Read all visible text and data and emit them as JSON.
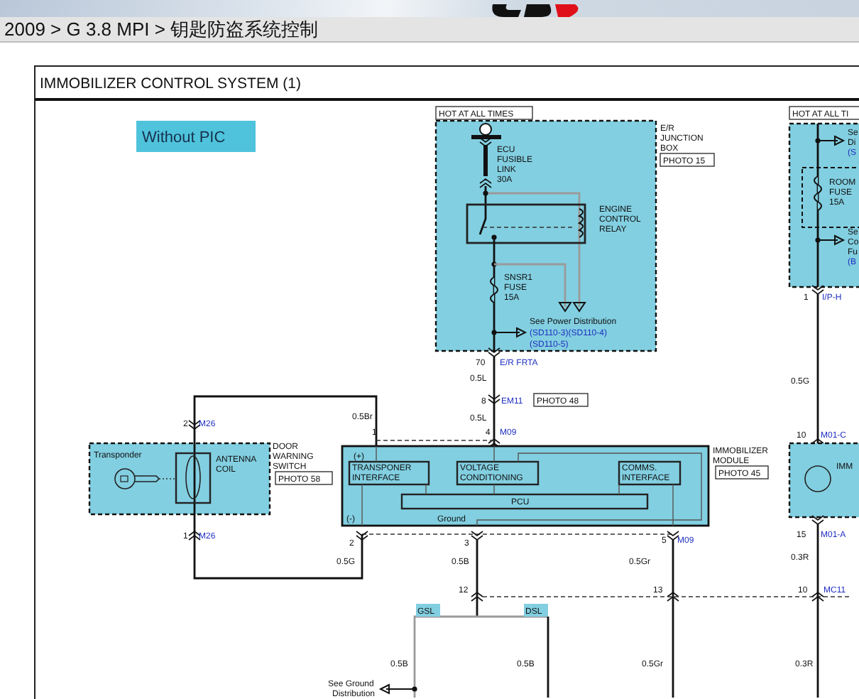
{
  "header": {
    "breadcrumb": "2009 > G 3.8 MPI > 钥匙防盗系统控制"
  },
  "diagram": {
    "title": "IMMOBILIZER CONTROL SYSTEM (1)",
    "mode_badge": "Without PIC",
    "labels": [
      {
        "kind": "tag",
        "text": "HOT AT ALL TIMES"
      },
      {
        "kind": "text",
        "text": "E/R"
      },
      {
        "kind": "text",
        "text": "JUNCTION"
      },
      {
        "kind": "text",
        "text": "BOX"
      },
      {
        "kind": "tag",
        "text": "PHOTO 15"
      },
      {
        "kind": "text",
        "text": "ECU"
      },
      {
        "kind": "text",
        "text": "FUSIBLE"
      },
      {
        "kind": "text",
        "text": "LINK"
      },
      {
        "kind": "text",
        "text": "30A"
      },
      {
        "kind": "text",
        "text": "ENGINE"
      },
      {
        "kind": "text",
        "text": "CONTROL"
      },
      {
        "kind": "text",
        "text": "RELAY"
      },
      {
        "kind": "text",
        "text": "SNSR1"
      },
      {
        "kind": "text",
        "text": "FUSE"
      },
      {
        "kind": "text",
        "text": "15A"
      },
      {
        "kind": "text",
        "text": "See Power Distribution"
      },
      {
        "kind": "link",
        "text": "(SD110-3)(SD110-4)"
      },
      {
        "kind": "link",
        "text": "(SD110-5)"
      },
      {
        "kind": "text",
        "text": "70"
      },
      {
        "kind": "link",
        "text": "E/R FRTA"
      },
      {
        "kind": "text",
        "text": "0.5L"
      },
      {
        "kind": "text",
        "text": "8"
      },
      {
        "kind": "link",
        "text": "EM11"
      },
      {
        "kind": "tag",
        "text": "PHOTO 48"
      },
      {
        "kind": "text",
        "text": "0.5L"
      },
      {
        "kind": "text",
        "text": "0.5Br"
      },
      {
        "kind": "text",
        "text": "1"
      },
      {
        "kind": "text",
        "text": "4"
      },
      {
        "kind": "link",
        "text": "M09"
      },
      {
        "kind": "text",
        "text": "2"
      },
      {
        "kind": "link",
        "text": "M26"
      },
      {
        "kind": "text",
        "text": "Transponder"
      },
      {
        "kind": "text",
        "text": "ANTENNA"
      },
      {
        "kind": "text",
        "text": "COIL"
      },
      {
        "kind": "text",
        "text": "DOOR"
      },
      {
        "kind": "text",
        "text": "WARNING"
      },
      {
        "kind": "text",
        "text": "SWITCH"
      },
      {
        "kind": "tag",
        "text": "PHOTO 58"
      },
      {
        "kind": "text",
        "text": "1"
      },
      {
        "kind": "link",
        "text": "M26"
      },
      {
        "kind": "text",
        "text": "(+)"
      },
      {
        "kind": "text",
        "text": "TRANSPONER"
      },
      {
        "kind": "text",
        "text": "INTERFACE"
      },
      {
        "kind": "text",
        "text": "VOLTAGE"
      },
      {
        "kind": "text",
        "text": "CONDITIONING"
      },
      {
        "kind": "text",
        "text": "COMMS."
      },
      {
        "kind": "text",
        "text": "INTERFACE"
      },
      {
        "kind": "text",
        "text": "PCU"
      },
      {
        "kind": "text",
        "text": "(-)"
      },
      {
        "kind": "text",
        "text": "Ground"
      },
      {
        "kind": "text",
        "text": "IMMOBILIZER"
      },
      {
        "kind": "text",
        "text": "MODULE"
      },
      {
        "kind": "tag",
        "text": "PHOTO 45"
      },
      {
        "kind": "text",
        "text": "2"
      },
      {
        "kind": "text",
        "text": "3"
      },
      {
        "kind": "text",
        "text": "5"
      },
      {
        "kind": "link",
        "text": "M09"
      },
      {
        "kind": "text",
        "text": "0.5G"
      },
      {
        "kind": "text",
        "text": "0.5B"
      },
      {
        "kind": "text",
        "text": "0.5Gr"
      },
      {
        "kind": "text",
        "text": "12"
      },
      {
        "kind": "text",
        "text": "13"
      },
      {
        "kind": "text",
        "text": "10"
      },
      {
        "kind": "link",
        "text": "MC11"
      },
      {
        "kind": "highlight",
        "text": "GSL"
      },
      {
        "kind": "highlight",
        "text": "DSL"
      },
      {
        "kind": "text",
        "text": "0.5B"
      },
      {
        "kind": "text",
        "text": "0.5B"
      },
      {
        "kind": "text",
        "text": "0.5Gr"
      },
      {
        "kind": "text",
        "text": "0.3R"
      },
      {
        "kind": "text",
        "text": "See Ground"
      },
      {
        "kind": "text",
        "text": "Distribution"
      },
      {
        "kind": "tag",
        "text": "HOT AT ALL TI"
      },
      {
        "kind": "text",
        "text": "Se"
      },
      {
        "kind": "text",
        "text": "Di"
      },
      {
        "kind": "link",
        "text": "(S"
      },
      {
        "kind": "text",
        "text": "ROOM"
      },
      {
        "kind": "text",
        "text": "FUSE"
      },
      {
        "kind": "text",
        "text": "15A"
      },
      {
        "kind": "text",
        "text": "Se"
      },
      {
        "kind": "text",
        "text": "Co"
      },
      {
        "kind": "text",
        "text": "Fu"
      },
      {
        "kind": "link",
        "text": "(B"
      },
      {
        "kind": "text",
        "text": "1"
      },
      {
        "kind": "link",
        "text": "I/P-H"
      },
      {
        "kind": "text",
        "text": "0.5G"
      },
      {
        "kind": "text",
        "text": "10"
      },
      {
        "kind": "link",
        "text": "M01-C"
      },
      {
        "kind": "text",
        "text": "IMM"
      },
      {
        "kind": "text",
        "text": "15"
      },
      {
        "kind": "link",
        "text": "M01-A"
      },
      {
        "kind": "text",
        "text": "0.3R"
      }
    ]
  }
}
